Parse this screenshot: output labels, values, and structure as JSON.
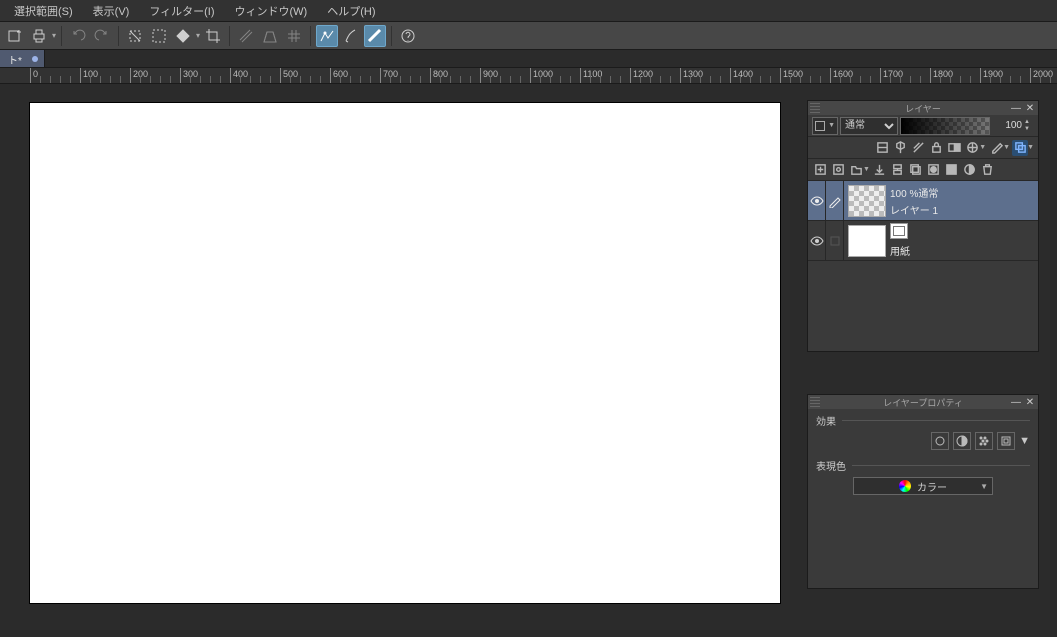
{
  "menu": {
    "selectRange": "選択範囲(S)",
    "view": "表示(V)",
    "filter": "フィルター(I)",
    "window": "ウィンドウ(W)",
    "help": "ヘルプ(H)"
  },
  "tab": {
    "name": "ト*",
    "dirty": true
  },
  "ruler": {
    "start": 0,
    "end": 2000,
    "step": 100,
    "pxPer100": 50
  },
  "layersPanel": {
    "title": "レイヤー",
    "blendMode": "通常",
    "opacity": 100,
    "items": [
      {
        "opacityLabel": "100 %通常",
        "name": "レイヤー 1",
        "selected": true,
        "visible": true,
        "editable": true,
        "thumb": "trans"
      },
      {
        "name": "用紙",
        "selected": false,
        "visible": true,
        "editable": false,
        "thumb": "white",
        "mini": true
      }
    ]
  },
  "propPanel": {
    "title": "レイヤープロパティ",
    "sections": {
      "effect": "効果",
      "color": "表現色"
    },
    "colorValue": "カラー"
  }
}
